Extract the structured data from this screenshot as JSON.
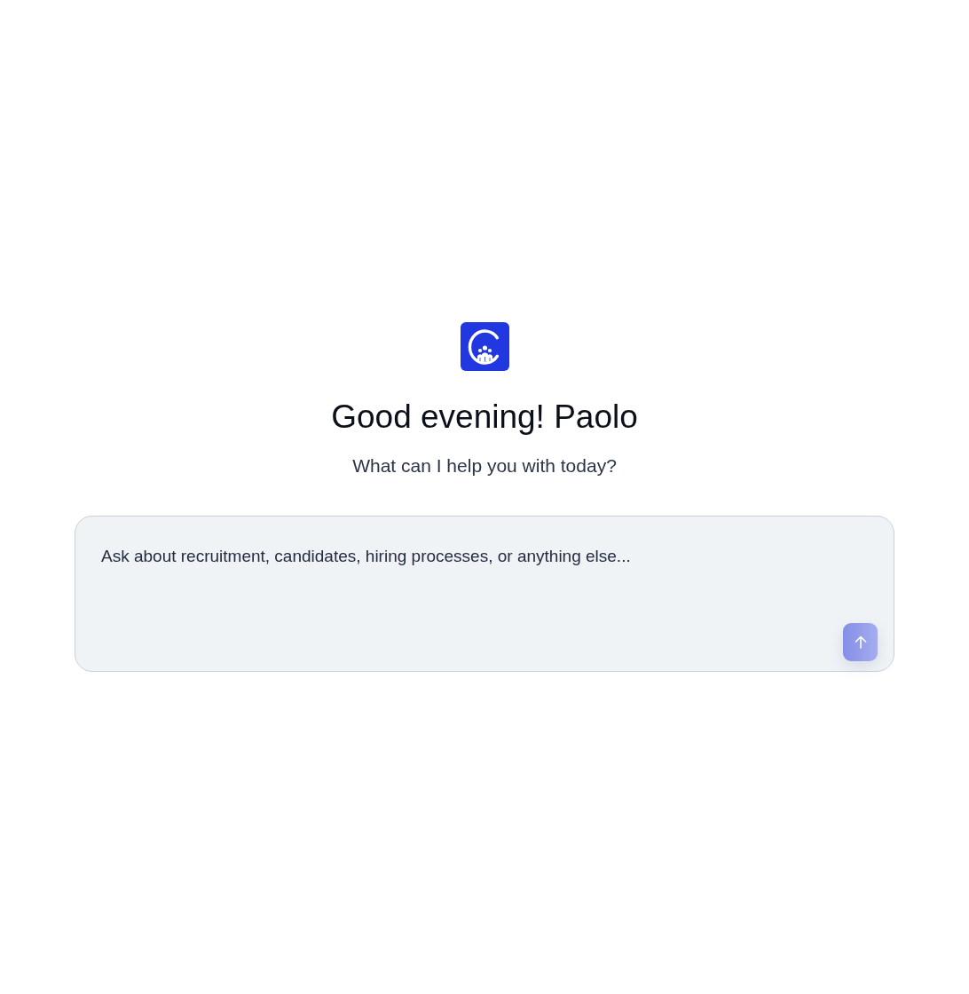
{
  "greeting": {
    "title": "Good evening! Paolo",
    "subtitle": "What can I help you with today?"
  },
  "composer": {
    "placeholder": "Ask about recruitment, candidates, hiring processes, or anything else...",
    "send_button": {
      "disabled": true
    }
  }
}
